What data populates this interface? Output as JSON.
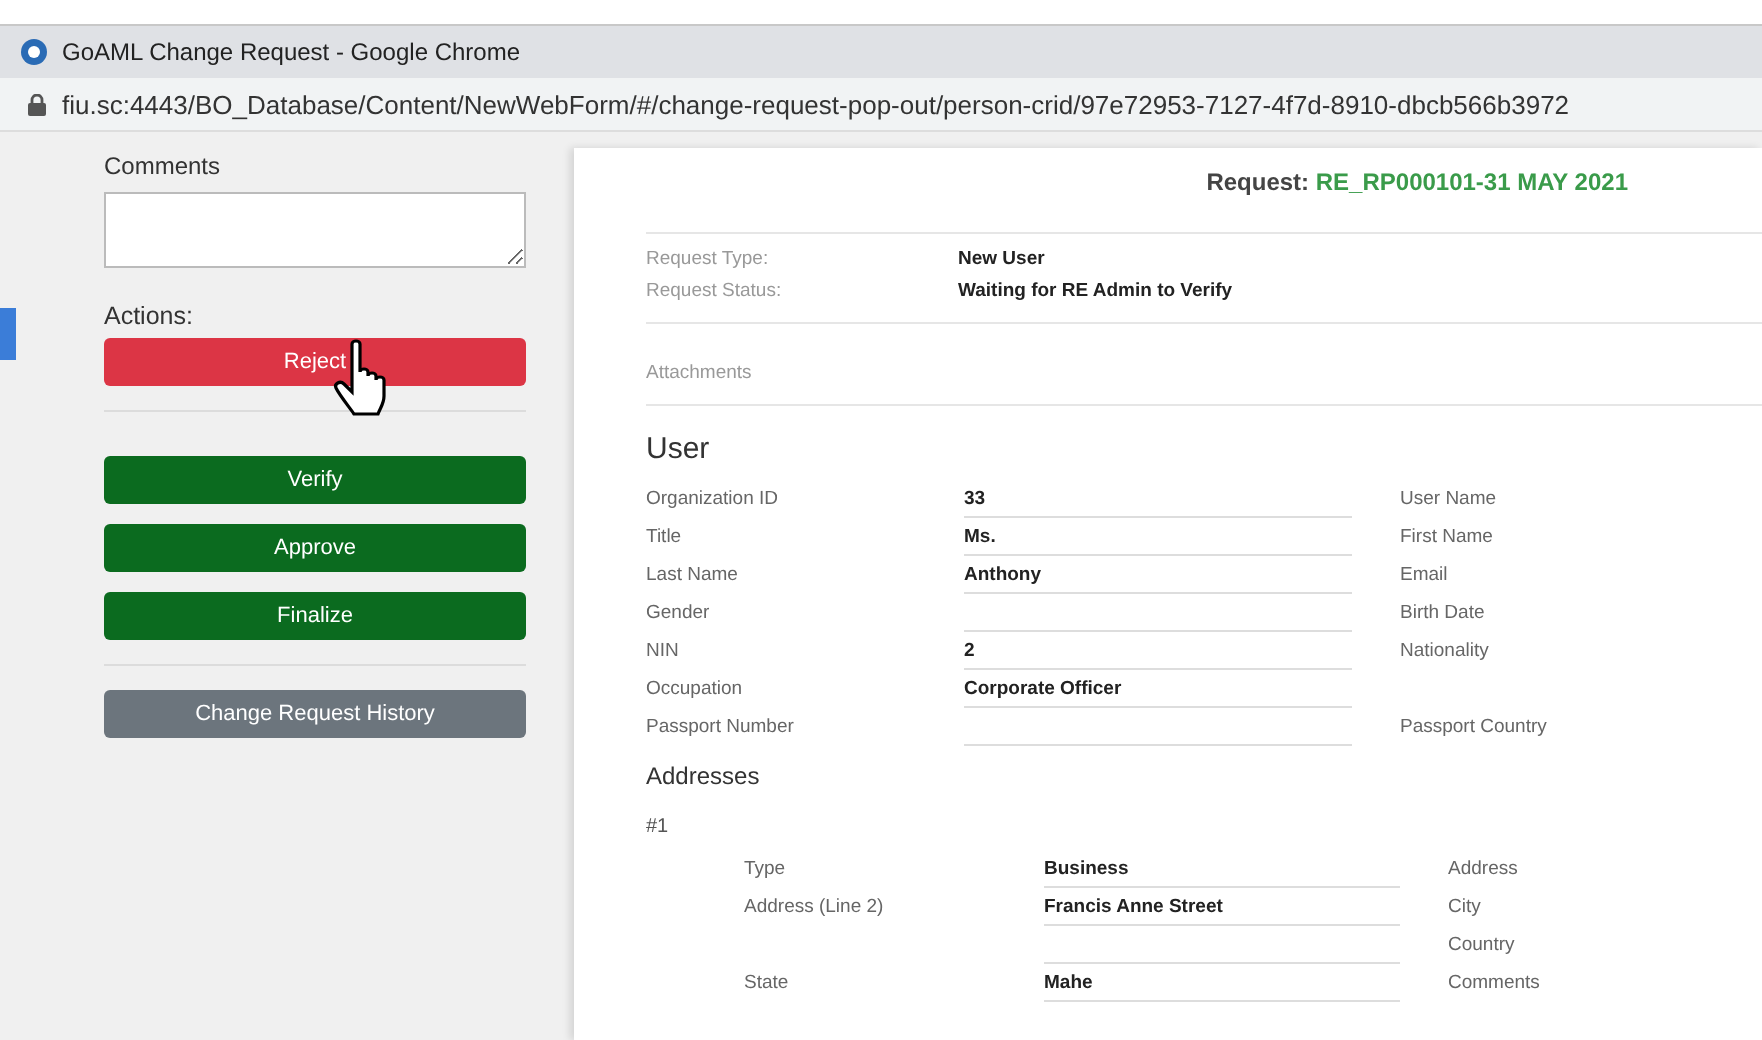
{
  "window": {
    "title": "GoAML Change Request - Google Chrome",
    "url": "fiu.sc:4443/BO_Database/Content/NewWebForm/#/change-request-pop-out/person-crid/97e72953-7127-4f7d-8910-dbcb566b3972"
  },
  "sidebar": {
    "comments_label": "Comments",
    "actions_label": "Actions:",
    "buttons": [
      {
        "label": "Reject",
        "kind": "danger"
      },
      {
        "label": "Verify",
        "kind": "success"
      },
      {
        "label": "Approve",
        "kind": "success"
      },
      {
        "label": "Finalize",
        "kind": "success"
      },
      {
        "label": "Change Request History",
        "kind": "secondary"
      }
    ]
  },
  "request": {
    "label": "Request:",
    "id": "RE_RP000101-31 MAY 2021"
  },
  "meta": [
    {
      "label": "Request Type:",
      "value": "New User"
    },
    {
      "label": "Request Status:",
      "value": "Waiting for RE Admin to Verify"
    }
  ],
  "attachments_label": "Attachments",
  "user": {
    "heading": "User",
    "rows": [
      {
        "label": "Organization ID",
        "value": "33",
        "right_label": "User Name"
      },
      {
        "label": "Title",
        "value": "Ms.",
        "right_label": "First Name"
      },
      {
        "label": "Last Name",
        "value": "Anthony",
        "right_label": "Email"
      },
      {
        "label": "Gender",
        "right_label": "Birth Date"
      },
      {
        "label": "NIN",
        "value": "2",
        "right_label": "Nationality"
      },
      {
        "label": "Occupation",
        "value": "Corporate Officer"
      },
      {
        "label": "Passport Number",
        "right_label": "Passport Country"
      }
    ]
  },
  "addresses": {
    "heading": "Addresses",
    "items": [
      {
        "number": "#1",
        "rows": [
          {
            "label": "Type",
            "value": "Business",
            "right_label": "Address"
          },
          {
            "label": "Address (Line 2)",
            "value": "Francis Anne Street",
            "right_label": "City"
          },
          {
            "right_label": "Country"
          },
          {
            "label": "State",
            "value": "Mahe",
            "right_label": "Comments"
          }
        ]
      }
    ]
  }
}
